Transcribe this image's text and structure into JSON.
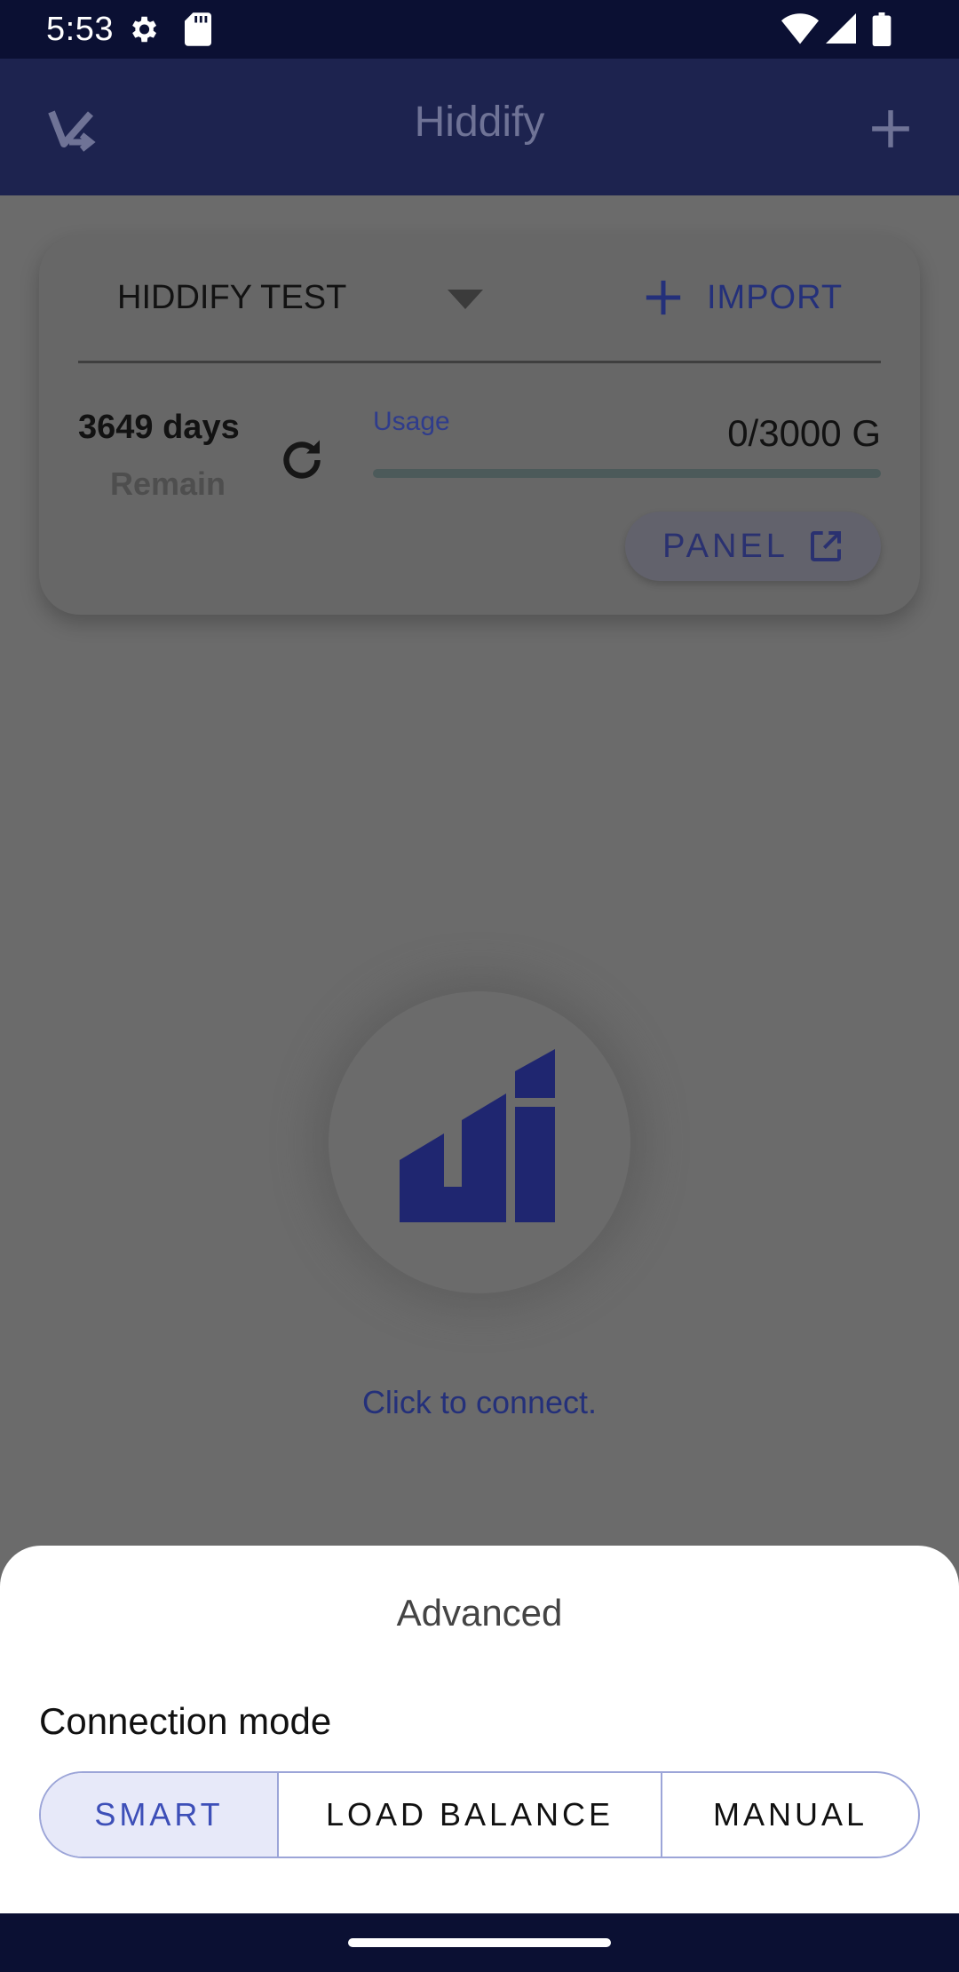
{
  "status_bar": {
    "time": "5:53",
    "icons": [
      "gear-icon",
      "sd-card-icon",
      "wifi-icon",
      "signal-icon",
      "battery-icon"
    ]
  },
  "app_bar": {
    "title": "Hiddify",
    "logo_icon": "hiddify-logo-icon",
    "add_icon": "plus-icon"
  },
  "profile_card": {
    "profile_name": "HIDDIFY TEST",
    "import_label": "IMPORT",
    "days_remaining": "3649 days",
    "remain_label": "Remain",
    "usage_label": "Usage",
    "usage_value": "0/3000 G",
    "usage_fraction": 0,
    "panel_label": "PANEL"
  },
  "connect": {
    "status_text": "Click to connect."
  },
  "sheet": {
    "title": "Advanced",
    "connection_mode_label": "Connection mode",
    "modes": [
      "SMART",
      "LOAD BALANCE",
      "MANUAL"
    ],
    "selected_mode": "SMART"
  },
  "colors": {
    "status_bar": "#0b1033",
    "app_bar": "#1d234f",
    "accent": "#3d4fb8",
    "scrim": "#6b6b6b",
    "sheet": "#ffffff"
  }
}
